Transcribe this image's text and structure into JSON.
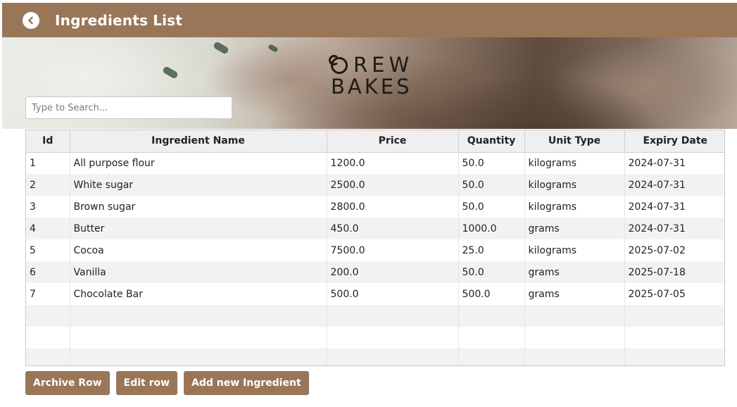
{
  "header": {
    "title": "Ingredients List",
    "back_icon": "chevron-left-icon",
    "background_color": "#9a7658"
  },
  "banner": {
    "logo_line1": "REW",
    "logo_line2": "BAKES"
  },
  "search": {
    "placeholder": "Type to Search...",
    "value": ""
  },
  "table": {
    "columns": [
      "Id",
      "Ingredient Name",
      "Price",
      "Quantity",
      "Unit Type",
      "Expiry Date"
    ],
    "rows": [
      [
        "1",
        "All purpose flour",
        "1200.0",
        "50.0",
        "kilograms",
        "2024-07-31"
      ],
      [
        "2",
        "White sugar",
        "2500.0",
        "50.0",
        "kilograms",
        "2024-07-31"
      ],
      [
        "3",
        "Brown sugar",
        "2800.0",
        "50.0",
        "kilograms",
        "2024-07-31"
      ],
      [
        "4",
        "Butter",
        "450.0",
        "1000.0",
        "grams",
        "2024-07-31"
      ],
      [
        "5",
        "Cocoa",
        "7500.0",
        "25.0",
        "kilograms",
        "2025-07-02"
      ],
      [
        "6",
        "Vanilla",
        "200.0",
        "50.0",
        "grams",
        "2025-07-18"
      ],
      [
        "7",
        "Chocolate Bar",
        "500.0",
        "500.0",
        "grams",
        "2025-07-05"
      ]
    ],
    "empty_rows": 3
  },
  "actions": {
    "archive_label": "Archive Row",
    "edit_label": "Edit row",
    "add_label": "Add new Ingredient",
    "button_color": "#9a7658"
  }
}
